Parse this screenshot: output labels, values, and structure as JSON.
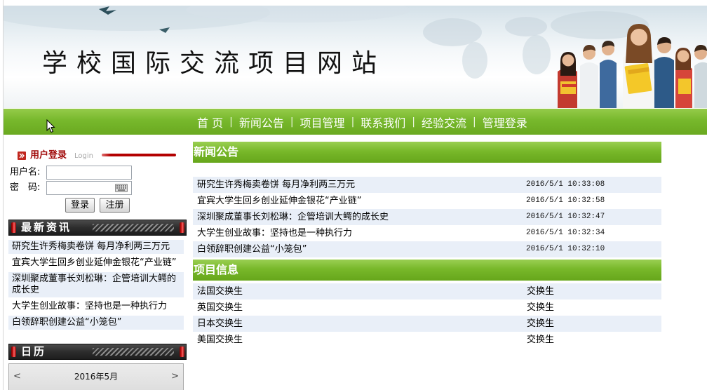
{
  "site": {
    "title": "学校国际交流项目网站"
  },
  "nav": {
    "separator": "|",
    "items": [
      {
        "label": "首 页"
      },
      {
        "label": "新闻公告"
      },
      {
        "label": "项目管理"
      },
      {
        "label": "联系我们"
      },
      {
        "label": "经验交流"
      },
      {
        "label": "管理登录"
      }
    ]
  },
  "login": {
    "title": "用户登录",
    "subtitle": "Login",
    "username_label": "用户名:",
    "username_value": "",
    "password_label": "密　码:",
    "password_value": "",
    "login_button": "登录",
    "register_button": "注册"
  },
  "latest_news": {
    "title": "最新资讯",
    "items": [
      "研究生许秀梅卖卷饼 每月净利两三万元",
      "宜宾大学生回乡创业延伸金银花“产业链”",
      "深圳聚成董事长刘松琳：企管培训大鳄的成长史",
      "大学生创业故事：坚持也是一种执行力",
      "白领辞职创建公益“小笼包”"
    ]
  },
  "calendar": {
    "title": "日历",
    "month_label": "2016年5月",
    "prev_label": "<",
    "next_label": ">"
  },
  "news": {
    "title": "新闻公告",
    "rows": [
      {
        "title": "研究生许秀梅卖卷饼 每月净利两三万元",
        "time": "2016/5/1 10:33:08"
      },
      {
        "title": "宜宾大学生回乡创业延伸金银花“产业链”",
        "time": "2016/5/1 10:32:58"
      },
      {
        "title": "深圳聚成董事长刘松琳：企管培训大鳄的成长史",
        "time": "2016/5/1 10:32:47"
      },
      {
        "title": "大学生创业故事：坚持也是一种执行力",
        "time": "2016/5/1 10:32:34"
      },
      {
        "title": "白领辞职创建公益“小笼包”",
        "time": "2016/5/1 10:32:10"
      }
    ]
  },
  "projects": {
    "title": "项目信息",
    "rows": [
      {
        "name": "法国交换生",
        "type": "交换生"
      },
      {
        "name": "英国交换生",
        "type": "交换生"
      },
      {
        "name": "日本交换生",
        "type": "交换生"
      },
      {
        "name": "美国交换生",
        "type": "交换生"
      }
    ]
  },
  "icons": {
    "login_header": "arrow-right-icon",
    "password_keyboard": "keyboard-icon",
    "bar_bullet": "red-bullet-icon",
    "mouse_cursor": "mouse-pointer-icon"
  },
  "colors": {
    "nav_green": "#77b82c",
    "header_green": "#78b82a",
    "row_highlight": "#e9eff8",
    "login_title": "#a10a0a",
    "login_rule": "#b30000",
    "dark_bar": "#2d2d2d",
    "bullet_red": "#d01818",
    "calendar_bg": "#dedede"
  }
}
